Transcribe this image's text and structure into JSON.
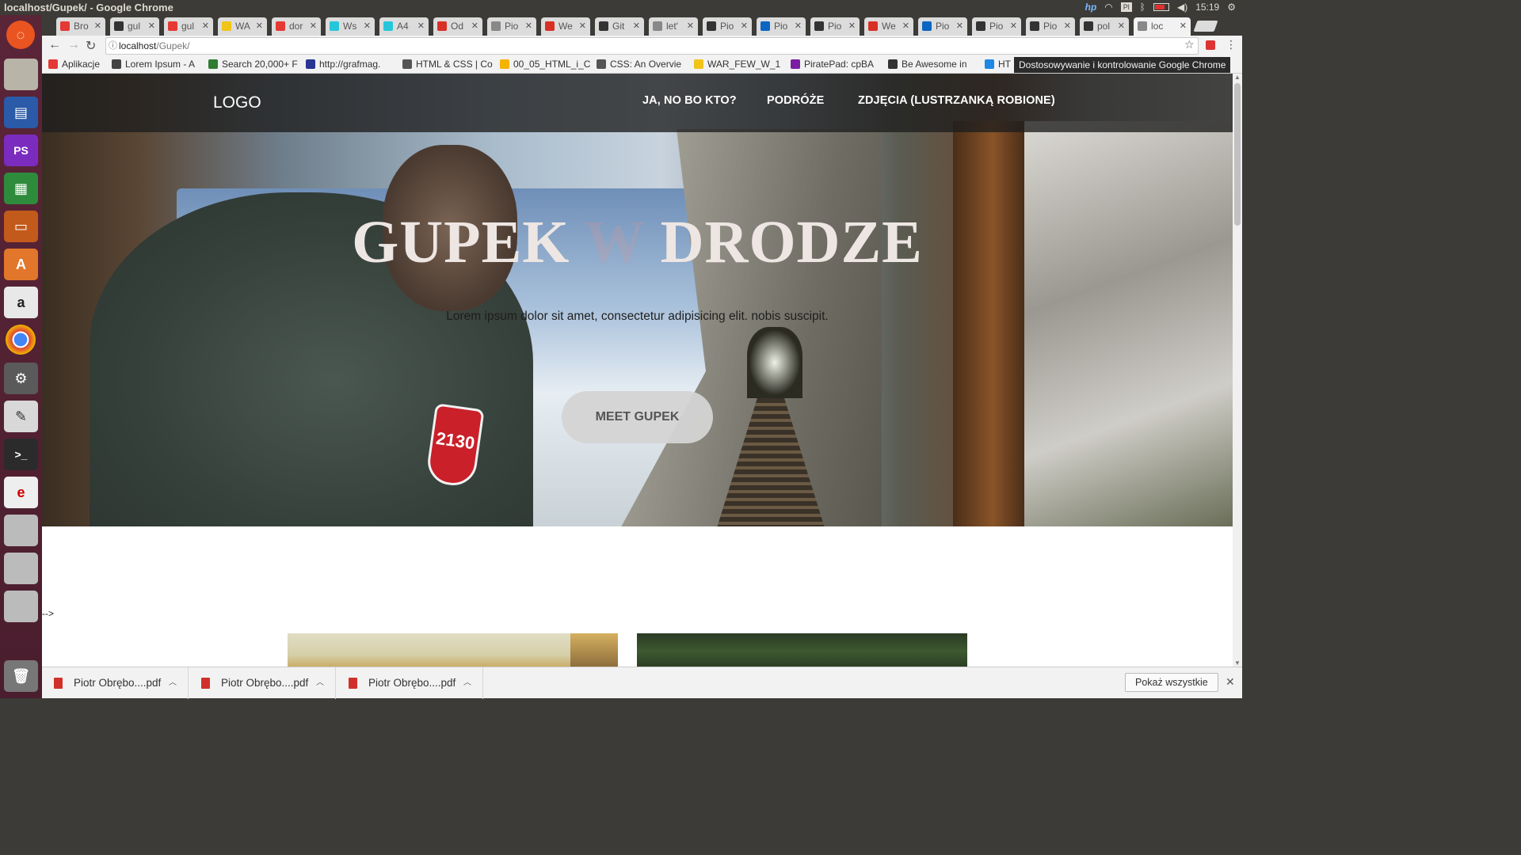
{
  "os": {
    "window_title": "localhost/Gupek/ - Google Chrome",
    "keyboard_layout": "Pl",
    "clock": "15:19"
  },
  "tabs": [
    {
      "label": "Bro",
      "icon_color": "#e53935"
    },
    {
      "label": "gul",
      "icon_color": "#333333"
    },
    {
      "label": "gul",
      "icon_color": "#e53935"
    },
    {
      "label": "WA",
      "icon_color": "#f0c419"
    },
    {
      "label": "dor",
      "icon_color": "#e53935"
    },
    {
      "label": "Ws",
      "icon_color": "#26c6da"
    },
    {
      "label": "A4",
      "icon_color": "#26c6da"
    },
    {
      "label": "Od",
      "icon_color": "#d93025"
    },
    {
      "label": "Pio",
      "icon_color": "#888888"
    },
    {
      "label": "We",
      "icon_color": "#d93025"
    },
    {
      "label": "Git",
      "icon_color": "#333333"
    },
    {
      "label": "let'",
      "icon_color": "#888888"
    },
    {
      "label": "Pio",
      "icon_color": "#333333"
    },
    {
      "label": "Pio",
      "icon_color": "#0a66c2"
    },
    {
      "label": "Pio",
      "icon_color": "#333333"
    },
    {
      "label": "We",
      "icon_color": "#d93025"
    },
    {
      "label": "Pio",
      "icon_color": "#0a66c2"
    },
    {
      "label": "Pio",
      "icon_color": "#333333"
    },
    {
      "label": "Pio",
      "icon_color": "#333333"
    },
    {
      "label": "pol",
      "icon_color": "#333333"
    },
    {
      "label": "loc",
      "icon_color": "#888888"
    }
  ],
  "address": {
    "host": "localhost",
    "path": "/Gupek/"
  },
  "bookmarks": [
    {
      "label": "Aplikacje",
      "icon_color": "#e53935"
    },
    {
      "label": "Lorem Ipsum - A",
      "icon_color": "#444444"
    },
    {
      "label": "Search 20,000+ F",
      "icon_color": "#2e7d32"
    },
    {
      "label": "http://grafmag.",
      "icon_color": "#283593"
    },
    {
      "label": "HTML & CSS | Co",
      "icon_color": "#555555"
    },
    {
      "label": "00_05_HTML_i_C",
      "icon_color": "#f4b400"
    },
    {
      "label": "CSS: An Overvie",
      "icon_color": "#555555"
    },
    {
      "label": "WAR_FEW_W_1",
      "icon_color": "#f0c419"
    },
    {
      "label": "PiratePad: cpBA",
      "icon_color": "#7b1fa2"
    },
    {
      "label": "Be Awesome in",
      "icon_color": "#333333"
    },
    {
      "label": "HT",
      "icon_color": "#1e88e5"
    }
  ],
  "tooltip": "Dostosowywanie i kontrolowanie Google Chrome",
  "site": {
    "logo": "LOGO",
    "nav": [
      "JA, NO BO KTO?",
      "PODRÓŻE",
      "ZDJĘCIA (LUSTRZANKĄ ROBIONE)"
    ],
    "hero_title_1": "GUPEK",
    "hero_title_2": "W",
    "hero_title_3": "DRODZE",
    "hero_sub": "Lorem ipsum dolor sit amet, consectetur adipisicing elit. nobis suscipit.",
    "hero_button": "MEET GUPEK",
    "badge_text": "2130",
    "stray_text": "-->"
  },
  "downloads": {
    "items": [
      "Piotr Obrębo....pdf",
      "Piotr Obrębo....pdf",
      "Piotr Obrębo....pdf"
    ],
    "show_all": "Pokaż wszystkie"
  }
}
